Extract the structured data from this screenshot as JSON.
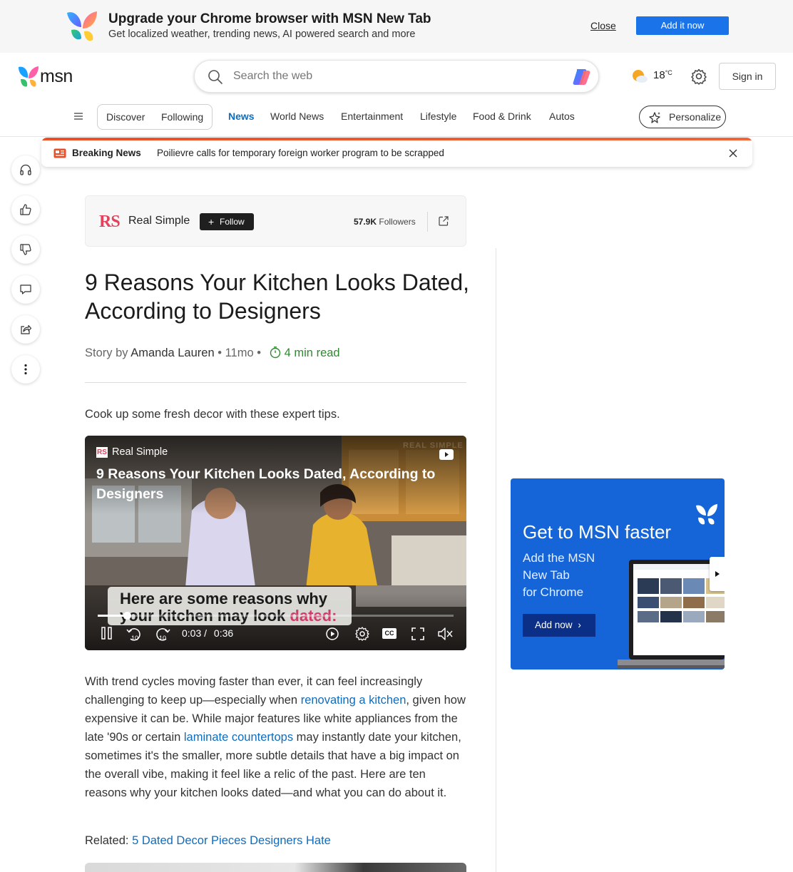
{
  "promo": {
    "title": "Upgrade your Chrome browser with MSN New Tab",
    "subtitle": "Get localized weather, trending news, AI powered search and more",
    "close_label": "Close",
    "add_label": "Add it now"
  },
  "header": {
    "logo_text": "msn",
    "search_placeholder": "Search the web",
    "weather_temp": "18",
    "weather_unit": "°C",
    "signin_label": "Sign in"
  },
  "nav": {
    "toggle": [
      "Discover",
      "Following"
    ],
    "items": [
      "News",
      "World News",
      "Entertainment",
      "Lifestyle",
      "Food & Drink",
      "Autos"
    ],
    "active": "News",
    "personalize_label": "Personalize"
  },
  "breaking": {
    "label": "Breaking News",
    "headline": "Poilievre calls for temporary foreign worker program to be scrapped"
  },
  "publisher": {
    "logo": "RS",
    "name": "Real Simple",
    "follow_label": "Follow",
    "followers_count": "57.9K",
    "followers_label": "Followers"
  },
  "article": {
    "headline": "9 Reasons Your Kitchen Looks Dated, According to Designers",
    "story_by": "Story by",
    "author": "Amanda Lauren",
    "age": "11mo",
    "read_time": "4 min read",
    "lede": "Cook up some fresh decor with these expert tips.",
    "body_1": "With trend cycles moving faster than ever, it can feel increasingly challenging to keep up—especially when ",
    "link_1": "renovating a kitchen",
    "body_2": ", given how expensive it can be. While major features like white appliances from the late '90s or certain ",
    "link_2": "laminate countertops",
    "body_3": " may instantly date your kitchen, sometimes it's the smaller, more subtle details that have a big impact on the overall vibe, making it feel like a relic of the past. Here are ten reasons why your kitchen looks dated—and what you can do about it.",
    "related_label": "Related:",
    "related_link": "5 Dated Decor Pieces Designers Hate"
  },
  "video": {
    "publisher_logo": "RS",
    "publisher": "Real Simple",
    "watermark": "REAL SIMPLE",
    "title": "9 Reasons Your Kitchen Looks Dated, According to Designers",
    "caption_line1": "Here are some reasons why",
    "caption_line2_pre": "your kitchen may look ",
    "caption_line2_hl": "dated:",
    "current_time": "0:03",
    "time_sep": "/",
    "duration": "0:36",
    "progress_fraction": 0.083,
    "skip_back": "10",
    "skip_fwd": "10",
    "cc_label": "CC"
  },
  "ad": {
    "title": "Get to MSN faster",
    "subtitle": "Add the MSN\nNew Tab\nfor Chrome",
    "button": "Add now"
  },
  "colors": {
    "accent": "#0f6cbd",
    "breaking_bar": "#e8502a",
    "read_time": "#2e8a2e",
    "ad_bg": "#1565d8",
    "brand_rs": "#e2425c"
  }
}
